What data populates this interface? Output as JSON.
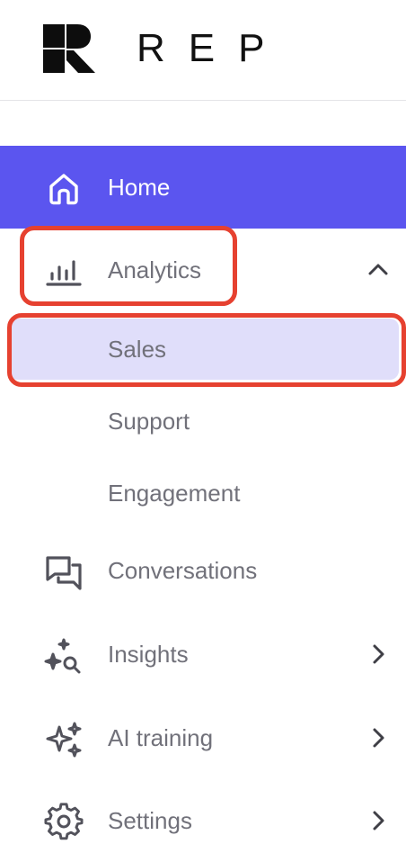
{
  "brand": {
    "name": "REP"
  },
  "nav": {
    "home": {
      "label": "Home",
      "icon": "home-icon"
    },
    "analytics": {
      "label": "Analytics",
      "icon": "bar-chart-icon",
      "expanded": true,
      "children": [
        {
          "label": "Sales",
          "selected": true
        },
        {
          "label": "Support"
        },
        {
          "label": "Engagement"
        }
      ]
    },
    "conversations": {
      "label": "Conversations",
      "icon": "chat-bubbles-icon"
    },
    "insights": {
      "label": "Insights",
      "icon": "sparkle-search-icon"
    },
    "ai_training": {
      "label": "AI training",
      "icon": "sparkles-icon"
    },
    "settings": {
      "label": "Settings",
      "icon": "gear-icon"
    }
  },
  "colors": {
    "accent": "#5b55ef",
    "selected_bg": "#e0defa",
    "annotation": "#e64130",
    "text_muted": "#71717a"
  }
}
